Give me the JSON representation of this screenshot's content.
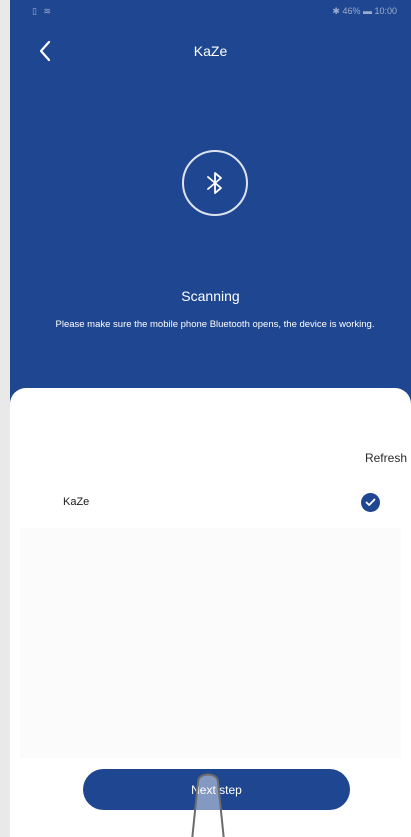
{
  "status_bar": {
    "left": "▯ ≋",
    "right": "✱ 46% ▬ 10:00"
  },
  "header": {
    "title": "KaZe",
    "back_icon": "chevron-left-icon",
    "bluetooth_icon": "bluetooth-icon",
    "scanning": "Scanning",
    "hint": "Please make sure the mobile phone Bluetooth opens, the device is working."
  },
  "sheet": {
    "refresh_label": "Refresh",
    "devices": [
      {
        "name": "KaZe",
        "selected": true
      }
    ],
    "next_label": "Next step"
  },
  "colors": {
    "primary": "#1f4690",
    "surface": "#ffffff",
    "text": "#1a1a1a"
  }
}
